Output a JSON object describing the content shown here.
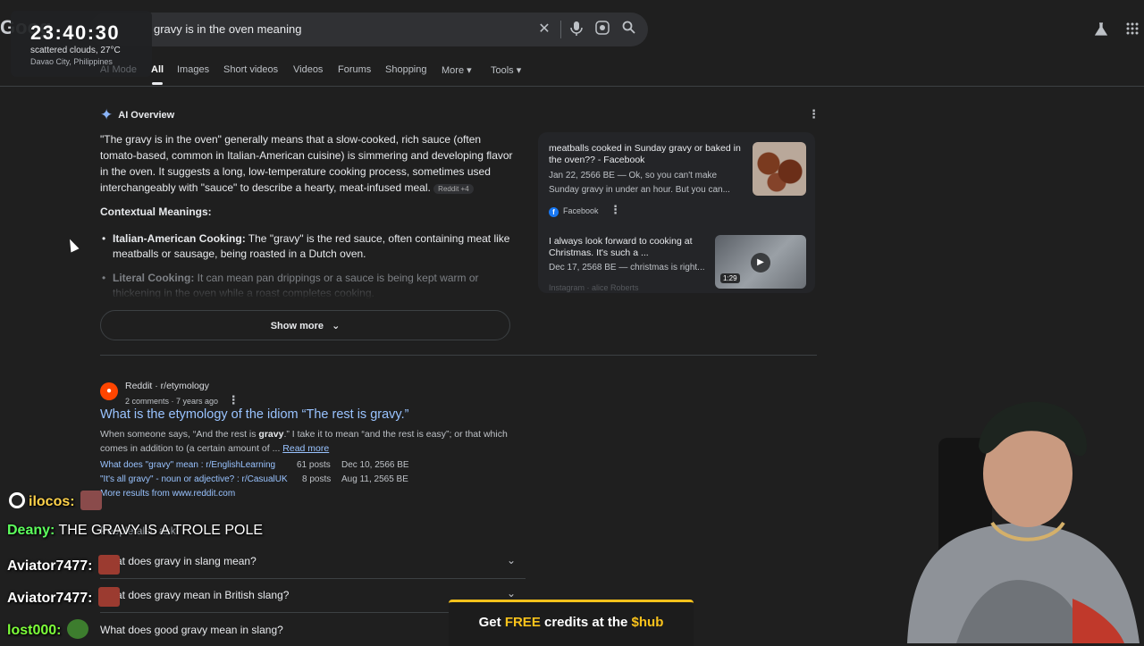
{
  "header": {
    "logo_text": "Goog",
    "search_query": "gravy is in the oven meaning",
    "clock": {
      "time": "23:40:30",
      "weather": "scattered clouds, 27°C",
      "location": "Davao City, Philippines"
    },
    "tabs": [
      {
        "label": "AI Mode"
      },
      {
        "label": "All"
      },
      {
        "label": "Images"
      },
      {
        "label": "Short videos"
      },
      {
        "label": "Videos"
      },
      {
        "label": "Forums"
      },
      {
        "label": "Shopping"
      },
      {
        "label": "More ▾"
      },
      {
        "label": "Tools ▾"
      }
    ]
  },
  "ai_overview": {
    "title": "AI Overview",
    "paragraph": "\"The gravy is in the oven\" generally means that a slow-cooked, rich sauce (often tomato-based, common in Italian-American cuisine) is simmering and developing flavor in the oven. It suggests a long, low-temperature cooking process, sometimes used interchangeably with \"sauce\" to describe a hearty, meat-infused meal.",
    "source_chip": "Reddit +4",
    "section_heading": "Contextual Meanings:",
    "bullets": [
      {
        "lead": "Italian-American Cooking:",
        "text": " The \"gravy\" is the red sauce, often containing meat like meatballs or sausage, being roasted in a Dutch oven."
      },
      {
        "lead": "Literal Cooking:",
        "text": " It can mean pan drippings or a sauce is being kept warm or thickening in the oven while a roast completes cooking."
      }
    ],
    "show_more": "Show more",
    "cards": [
      {
        "title": "meatballs cooked in Sunday gravy or baked in the oven?? - Facebook",
        "meta": "Jan 22, 2566 BE — Ok, so you can't make Sunday gravy in under an hour. But you can...",
        "source": "Facebook"
      },
      {
        "title": "I always look forward to cooking at Christmas. It's such a ...",
        "meta": "Dec 17, 2568 BE — christmas is right...",
        "source": "Instagram · alice Roberts",
        "duration": "1:29"
      }
    ]
  },
  "result": {
    "site": "Reddit · r/etymology",
    "sub": "2 comments · 7 years ago",
    "title": "What is the etymology of the idiom “The rest is gravy.”",
    "snippet_pre": "When someone says, “And the rest is ",
    "snippet_bold": "gravy",
    "snippet_post": ".” I take it to mean “and the rest is easy”; or that which comes in addition to (a certain amount of ...",
    "read_more": "Read more",
    "sublinks": [
      {
        "text": "What does \"gravy\" mean : r/EnglishLearning",
        "posts": "61 posts",
        "date": "Dec 10, 2566 BE"
      },
      {
        "text": "\"It's all gravy\" - noun or adjective? : r/CasualUK",
        "posts": "8 posts",
        "date": "Aug 11, 2565 BE"
      }
    ],
    "more_results": "More results from www.reddit.com"
  },
  "people_also_ask": {
    "heading": "People also ask",
    "questions": [
      "What does gravy in slang mean?",
      "What does gravy mean in British slang?",
      "What does good gravy mean in slang?"
    ]
  },
  "chat": [
    {
      "name": "ilocos:",
      "message": "",
      "name_color": "#ffd24a"
    },
    {
      "name": "Deany:",
      "message": "THE GRAVY IS A TROLE POLE",
      "name_color": "#5dff5d"
    },
    {
      "name": "Aviator7477:",
      "message": "",
      "name_color": "#ffffff"
    },
    {
      "name": "Aviator7477:",
      "message": "",
      "name_color": "#ffffff"
    },
    {
      "name": "lost000:",
      "message": "",
      "name_color": "#7dff3a"
    }
  ],
  "banner": {
    "pre": "Get ",
    "free": "FREE",
    "mid": " credits at the ",
    "brand": "$hub"
  },
  "colors": {
    "accent_link": "#99c3ff",
    "background": "#1f1f1f",
    "banner_yellow": "#f9c21b"
  }
}
